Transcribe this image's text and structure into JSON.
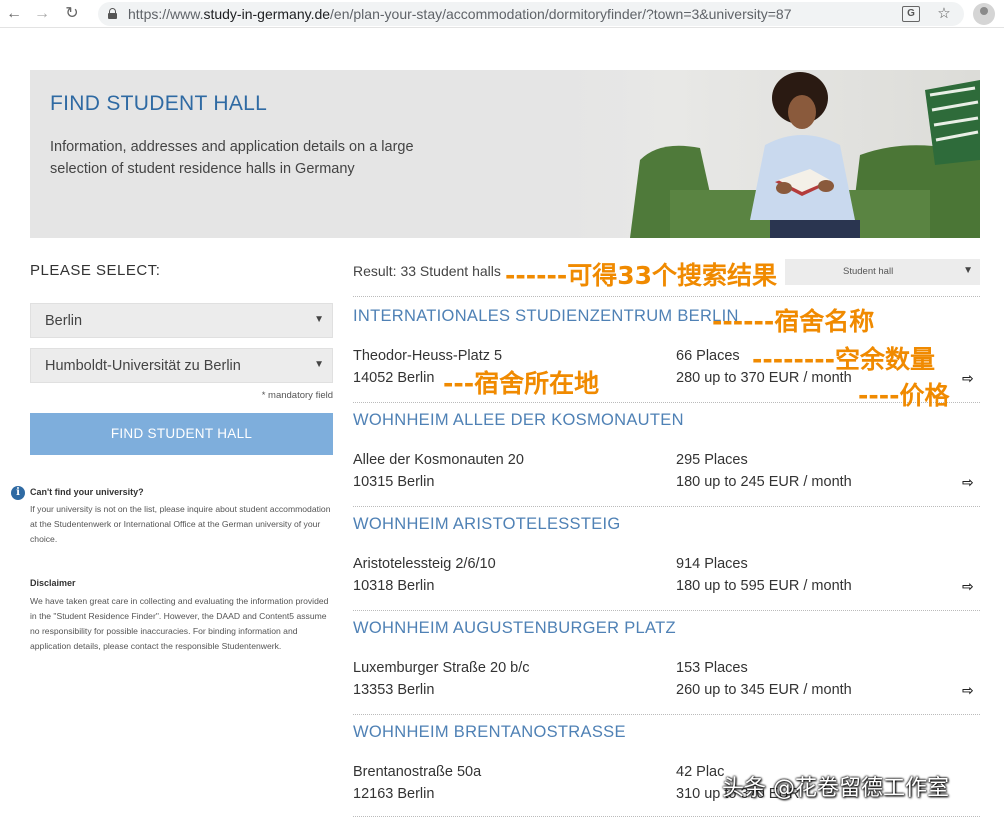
{
  "browser": {
    "url_prefix": "https://www.",
    "url_host": "study-in-germany.de",
    "url_path": "/en/plan-your-stay/accommodation/dormitoryfinder/?town=3&university=87"
  },
  "hero": {
    "title": "FIND STUDENT HALL",
    "subtitle": "Information, addresses and application details on a large selection of student residence halls in Germany"
  },
  "sidebar": {
    "heading": "PLEASE SELECT:",
    "city": "Berlin",
    "university": "Humboldt-Universität zu Berlin",
    "mandatory": "* mandatory field",
    "button": "FIND STUDENT HALL",
    "cant_find_title": "Can't find your university?",
    "cant_find_text": "If your university is not on the list, please inquire about student accommodation at the Studentenwerk or International Office at the German university of your choice.",
    "disclaimer_title": "Disclaimer",
    "disclaimer_text": "We have taken great care in collecting and evaluating the information provided in the \"Student Residence Finder\". However, the DAAD and Content5 assume no responsibility for possible inaccuracies. For binding information and application details, please contact the responsible Studentenwerk."
  },
  "results": {
    "count": "Result: 33 Student halls",
    "sort_label": "Student hall",
    "halls": [
      {
        "name": "INTERNATIONALES STUDIENZENTRUM BERLIN",
        "street": "Theodor-Heuss-Platz 5",
        "city": "14052 Berlin",
        "places": "66 Places",
        "price": "280 up to 370 EUR / month"
      },
      {
        "name": "WOHNHEIM ALLEE DER KOSMONAUTEN",
        "street": "Allee der Kosmonauten 20",
        "city": "10315 Berlin",
        "places": "295 Places",
        "price": "180 up to 245 EUR / month"
      },
      {
        "name": "WOHNHEIM ARISTOTELESSTEIG",
        "street": "Aristotelessteig 2/6/10",
        "city": "10318 Berlin",
        "places": "914 Places",
        "price": "180 up to 595 EUR / month"
      },
      {
        "name": "WOHNHEIM AUGUSTENBURGER PLATZ",
        "street": "Luxemburger Straße 20 b/c",
        "city": "13353 Berlin",
        "places": "153 Places",
        "price": "260 up to 345 EUR / month"
      },
      {
        "name": "WOHNHEIM BRENTANOSTRASSE",
        "street": "Brentanostraße 50a",
        "city": "12163 Berlin",
        "places": "42 Plac",
        "price": "310 up to 370 EUR"
      }
    ]
  },
  "annotations": {
    "results": "------可得33个搜索结果",
    "name": "------宿舍名称",
    "places": "--------空余数量",
    "location": "---宿舍所在地",
    "price": "----价格"
  },
  "watermark": "头条 @花卷留德工作室",
  "colors": {
    "accent_blue": "#2f6aa3",
    "hall_name": "#4f81b5",
    "button": "#7eaedc",
    "annotation": "#f08a00"
  }
}
